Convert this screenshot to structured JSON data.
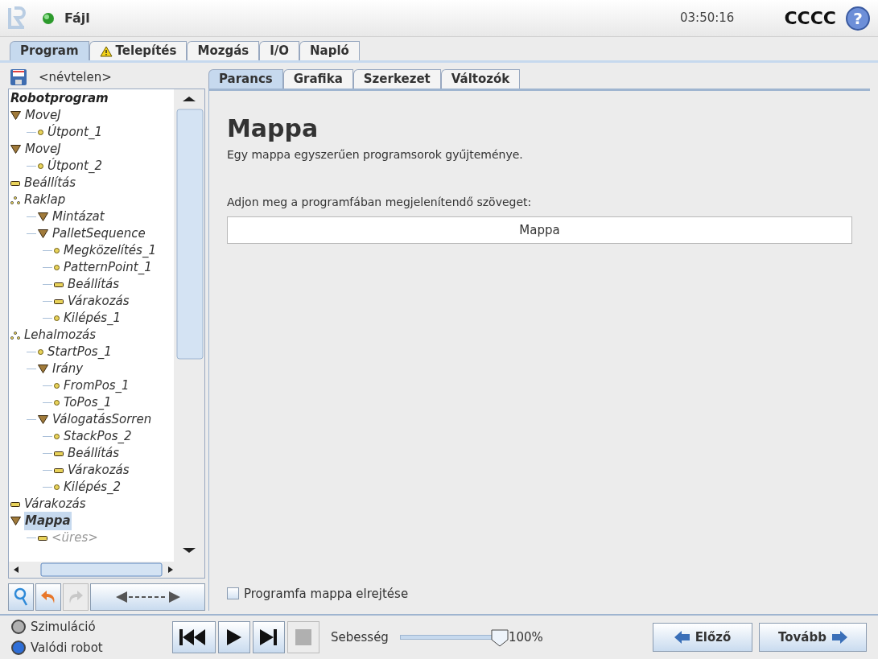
{
  "header": {
    "menu": "Fájl",
    "time": "03:50:16",
    "robot_name": "CCCC",
    "help": "?"
  },
  "main_tabs": [
    {
      "label": "Program",
      "selected": true,
      "warning": false
    },
    {
      "label": "Telepítés",
      "selected": false,
      "warning": true
    },
    {
      "label": "Mozgás",
      "selected": false,
      "warning": false
    },
    {
      "label": "I/O",
      "selected": false,
      "warning": false
    },
    {
      "label": "Napló",
      "selected": false,
      "warning": false
    }
  ],
  "file_name": "<névtelen>",
  "sub_tabs": [
    {
      "label": "Parancs",
      "selected": true
    },
    {
      "label": "Grafika",
      "selected": false
    },
    {
      "label": "Szerkezet",
      "selected": false
    },
    {
      "label": "Változók",
      "selected": false
    }
  ],
  "tree": {
    "root": "Robotprogram",
    "items": [
      {
        "label": "MoveJ",
        "kind": "folder",
        "selected": false,
        "children": [
          {
            "label": "Útpont_1",
            "kind": "waypoint",
            "selected": false
          }
        ]
      },
      {
        "label": "MoveJ",
        "kind": "folder",
        "selected": false,
        "children": [
          {
            "label": "Útpont_2",
            "kind": "waypoint",
            "selected": false
          }
        ]
      },
      {
        "label": "Beállítás",
        "kind": "action",
        "selected": false
      },
      {
        "label": "Raklap",
        "kind": "pallet",
        "selected": false,
        "children": [
          {
            "label": "Mintázat",
            "kind": "folder",
            "selected": false
          },
          {
            "label": "PalletSequence",
            "kind": "folder",
            "selected": false,
            "children": [
              {
                "label": "Megközelítés_1",
                "kind": "waypoint",
                "selected": false
              },
              {
                "label": "PatternPoint_1",
                "kind": "waypoint",
                "selected": false
              },
              {
                "label": "Beállítás",
                "kind": "action",
                "selected": false
              },
              {
                "label": "Várakozás",
                "kind": "action",
                "selected": false
              },
              {
                "label": "Kilépés_1",
                "kind": "waypoint",
                "selected": false
              }
            ]
          }
        ]
      },
      {
        "label": "Lehalmozás",
        "kind": "pallet",
        "selected": false,
        "children": [
          {
            "label": "StartPos_1",
            "kind": "waypoint",
            "selected": false
          },
          {
            "label": "Irány",
            "kind": "folder",
            "selected": false,
            "children": [
              {
                "label": "FromPos_1",
                "kind": "waypoint",
                "selected": false
              },
              {
                "label": "ToPos_1",
                "kind": "waypoint",
                "selected": false
              }
            ]
          },
          {
            "label": "VálogatásSorren",
            "kind": "folder",
            "selected": false,
            "children": [
              {
                "label": "StackPos_2",
                "kind": "waypoint",
                "selected": false
              },
              {
                "label": "Beállítás",
                "kind": "action",
                "selected": false
              },
              {
                "label": "Várakozás",
                "kind": "action",
                "selected": false
              },
              {
                "label": "Kilépés_2",
                "kind": "waypoint",
                "selected": false
              }
            ]
          }
        ]
      },
      {
        "label": "Várakozás",
        "kind": "action",
        "selected": false
      },
      {
        "label": "Mappa",
        "kind": "folder",
        "selected": true,
        "children": [
          {
            "label": "<üres>",
            "kind": "empty",
            "selected": false
          }
        ]
      }
    ]
  },
  "content": {
    "title": "Mappa",
    "description": "Egy mappa egyszerűen programsorok gyűjteménye.",
    "field_label": "Adjon meg a programfában megjelenítendő szöveget:",
    "field_value": "Mappa",
    "hide_checkbox": {
      "label": "Programfa mappa elrejtése",
      "checked": false
    }
  },
  "modes": [
    {
      "label": "Szimuláció",
      "selected": false
    },
    {
      "label": "Valódi robot",
      "selected": true
    }
  ],
  "transport": {
    "stop_disabled": true
  },
  "speed": {
    "label": "Sebesség",
    "level": 1.0,
    "reading": "100%"
  },
  "nav": {
    "prev": "Előző",
    "next": "Tovább"
  }
}
